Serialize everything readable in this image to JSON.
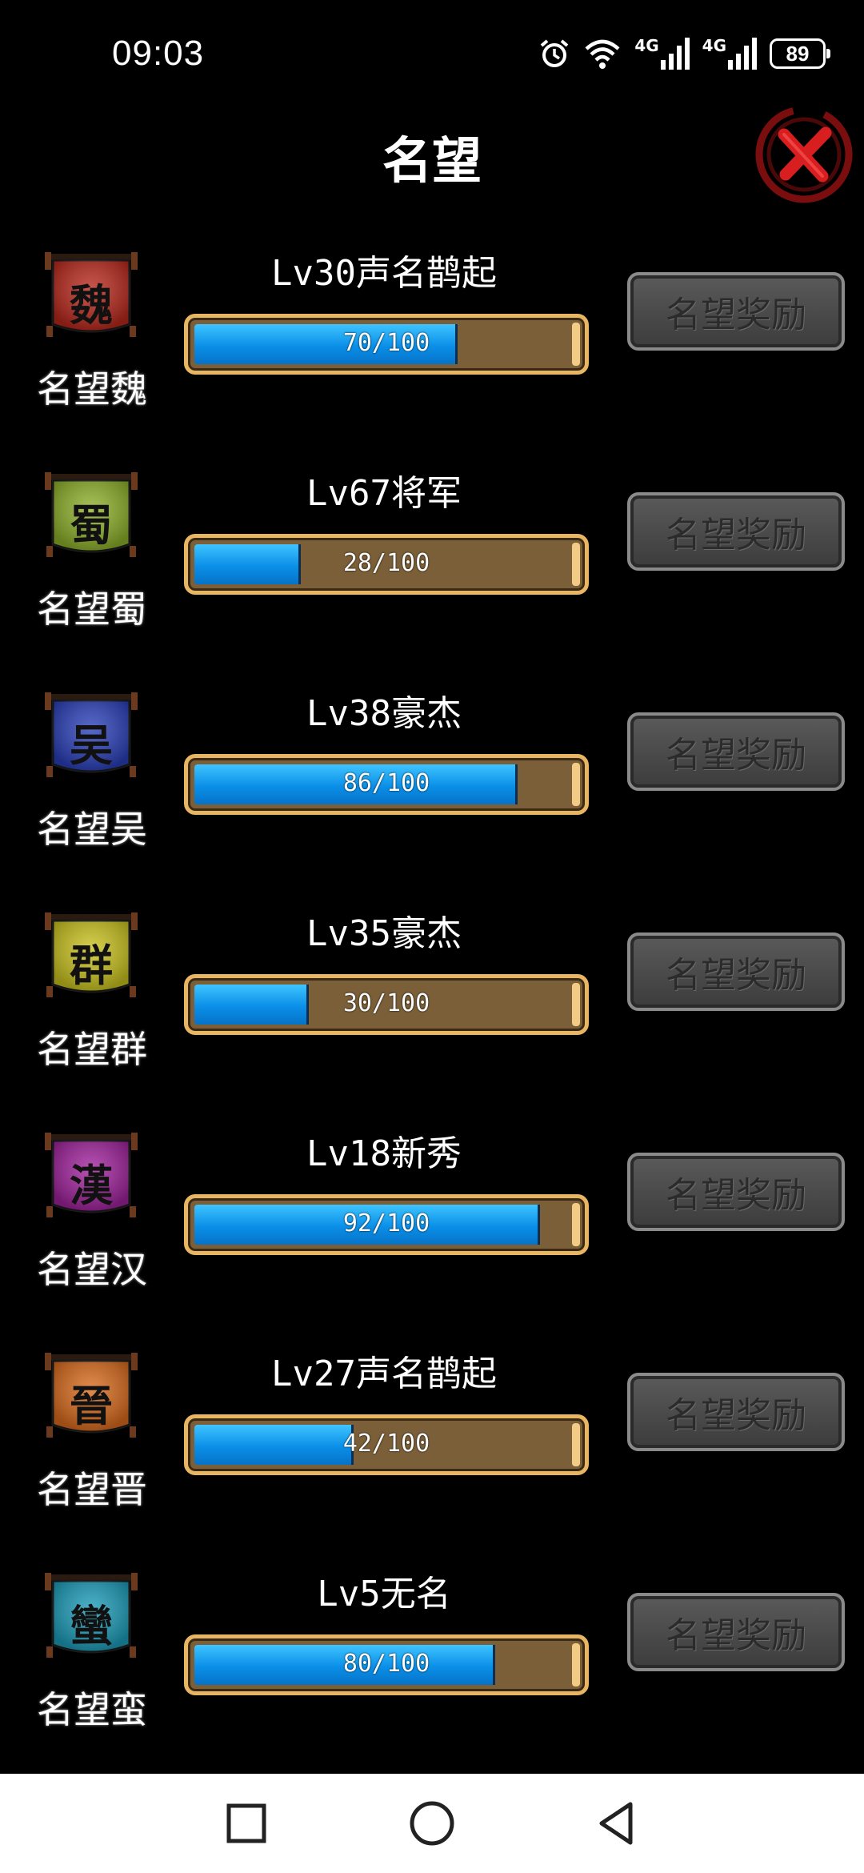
{
  "status_bar": {
    "time": "09:03",
    "network_1": "4G",
    "network_2": "4G",
    "battery": "89"
  },
  "header": {
    "title": "名望"
  },
  "factions": [
    {
      "banner_char": "魏",
      "name": "名望魏",
      "rank": "Lv30声名鹊起",
      "progress_text": "70/100",
      "progress": 0.7,
      "banner_color": "#b8281c",
      "reward_label": "名望奖励"
    },
    {
      "banner_char": "蜀",
      "name": "名望蜀",
      "rank": "Lv67将军",
      "progress_text": "28/100",
      "progress": 0.28,
      "banner_color": "#8db02a",
      "reward_label": "名望奖励"
    },
    {
      "banner_char": "吴",
      "name": "名望吴",
      "rank": "Lv38豪杰",
      "progress_text": "86/100",
      "progress": 0.86,
      "banner_color": "#2a3fb8",
      "reward_label": "名望奖励"
    },
    {
      "banner_char": "群",
      "name": "名望群",
      "rank": "Lv35豪杰",
      "progress_text": "30/100",
      "progress": 0.3,
      "banner_color": "#c9c21e",
      "reward_label": "名望奖励"
    },
    {
      "banner_char": "漢",
      "name": "名望汉",
      "rank": "Lv18新秀",
      "progress_text": "92/100",
      "progress": 0.92,
      "banner_color": "#a0229c",
      "reward_label": "名望奖励"
    },
    {
      "banner_char": "晉",
      "name": "名望晋",
      "rank": "Lv27声名鹊起",
      "progress_text": "42/100",
      "progress": 0.42,
      "banner_color": "#d86a1c",
      "reward_label": "名望奖励"
    },
    {
      "banner_char": "蠻",
      "name": "名望蛮",
      "rank": "Lv5无名",
      "progress_text": "80/100",
      "progress": 0.8,
      "banner_color": "#1c9cb8",
      "reward_label": "名望奖励"
    }
  ],
  "colors": {
    "progress_fill": "#0a8fe8",
    "progress_frame": "#e8b563",
    "progress_track": "#7b5f38",
    "close_accent": "#d81e1e"
  },
  "icons": {
    "close": "close-x-icon",
    "alarm": "alarm-icon",
    "wifi": "wifi-icon",
    "nav_recents": "square-icon",
    "nav_home": "circle-icon",
    "nav_back": "triangle-back-icon"
  }
}
